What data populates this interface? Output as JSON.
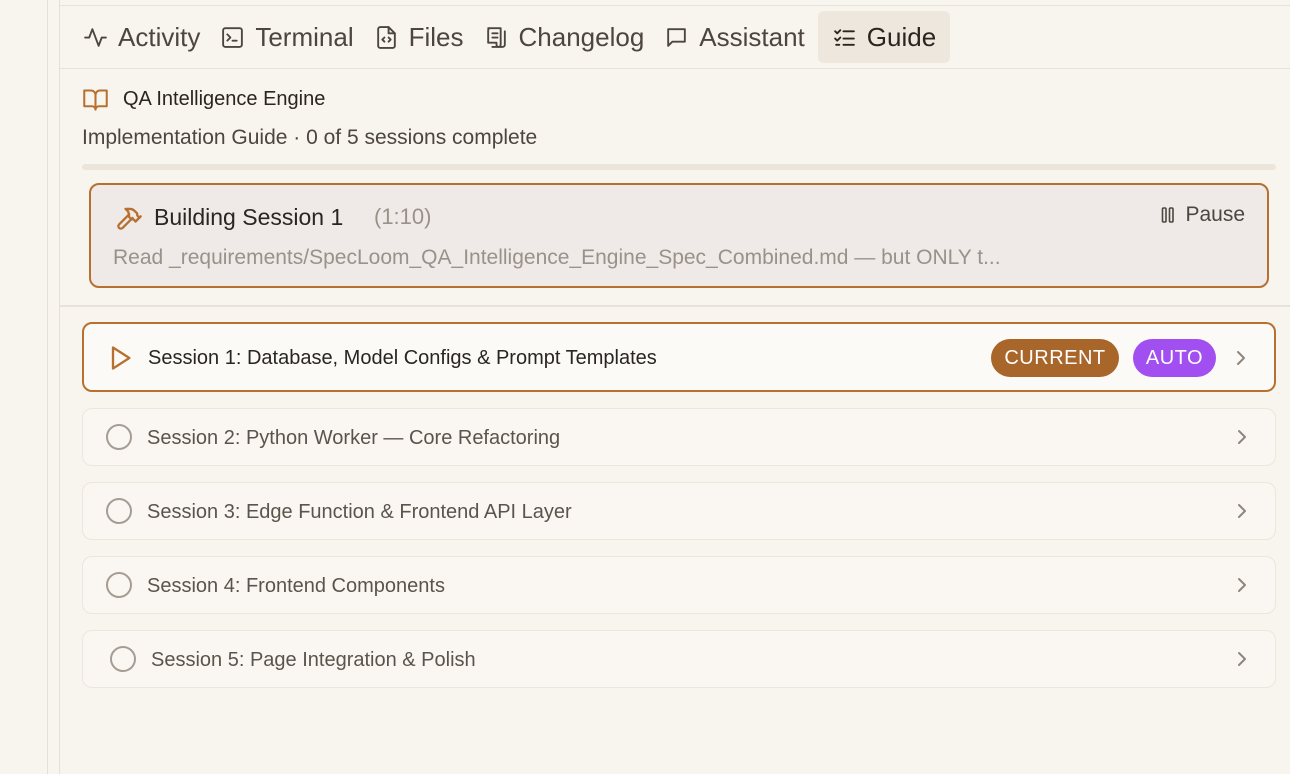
{
  "tabs": [
    {
      "label": "Activity",
      "icon": "activity-icon"
    },
    {
      "label": "Terminal",
      "icon": "terminal-icon"
    },
    {
      "label": "Files",
      "icon": "file-code-icon"
    },
    {
      "label": "Changelog",
      "icon": "scroll-icon"
    },
    {
      "label": "Assistant",
      "icon": "message-icon"
    },
    {
      "label": "Guide",
      "icon": "list-checks-icon",
      "active": true
    }
  ],
  "guide": {
    "project_name": "QA Intelligence Engine",
    "subtitle": "Implementation Guide · 0 of 5 sessions complete",
    "progress_fraction": 0
  },
  "building": {
    "title": "Building Session 1",
    "elapsed": "(1:10)",
    "pause_label": "Pause",
    "description": "Read _requirements/SpecLoom_QA_Intelligence_Engine_Spec_Combined.md — but ONLY t..."
  },
  "sessions": [
    {
      "label": "Session 1: Database, Model Configs & Prompt Templates",
      "status": "current",
      "badges": [
        "CURRENT",
        "AUTO"
      ]
    },
    {
      "label": "Session 2: Python Worker — Core Refactoring",
      "status": "pending"
    },
    {
      "label": "Session 3: Edge Function & Frontend API Layer",
      "status": "pending"
    },
    {
      "label": "Session 4: Frontend Components",
      "status": "pending"
    },
    {
      "label": "Session 5: Page Integration & Polish",
      "status": "pending"
    }
  ],
  "colors": {
    "accent": "#b06c2c",
    "current_badge": "#a8662a",
    "auto_badge": "#a14ff0",
    "background": "#f8f4ee"
  }
}
